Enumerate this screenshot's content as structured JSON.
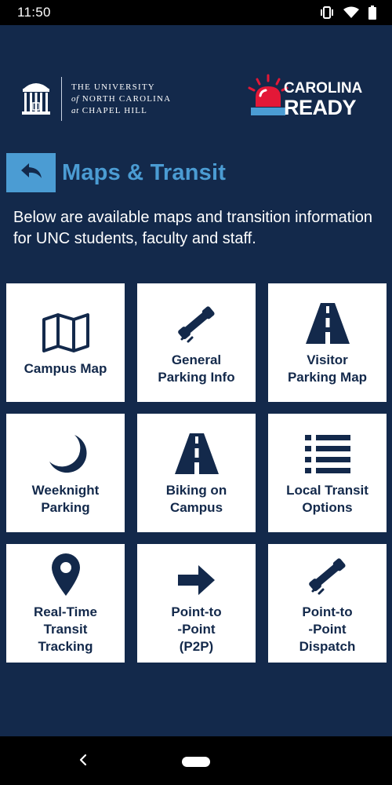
{
  "status_bar": {
    "time": "11:50",
    "icons": [
      "vibrate-icon",
      "wifi-icon",
      "battery-icon"
    ]
  },
  "header": {
    "unc_logo": {
      "line1": "THE UNIVERSITY",
      "line2_prefix": "of",
      "line2_main": "NORTH CAROLINA",
      "line3_prefix": "at",
      "line3_main": "CHAPEL HILL"
    },
    "carolina_ready": {
      "line1": "CAROLINA",
      "line2": "READY",
      "accent_color": "#e31837"
    }
  },
  "page": {
    "title": "Maps & Transit",
    "intro": "Below are available maps and transition information for UNC students, faculty and staff."
  },
  "tiles": [
    {
      "label": "Campus Map",
      "icon": "map-icon"
    },
    {
      "label": "General\nParking Info",
      "icon": "phone-icon"
    },
    {
      "label": "Visitor\nParking Map",
      "icon": "road-icon"
    },
    {
      "label": "Weeknight\nParking",
      "icon": "moon-icon"
    },
    {
      "label": "Biking on\nCampus",
      "icon": "road-icon"
    },
    {
      "label": "Local Transit\nOptions",
      "icon": "list-icon"
    },
    {
      "label": "Real-Time\nTransit\nTracking",
      "icon": "map-marker-icon"
    },
    {
      "label": "Point-to\n-Point\n(P2P)",
      "icon": "arrow-right-icon"
    },
    {
      "label": "Point-to\n-Point\nDispatch",
      "icon": "phone-icon"
    }
  ],
  "colors": {
    "background": "#13294b",
    "accent_blue": "#4b9cd3",
    "tile_bg": "#ffffff",
    "tile_text": "#13294b"
  }
}
